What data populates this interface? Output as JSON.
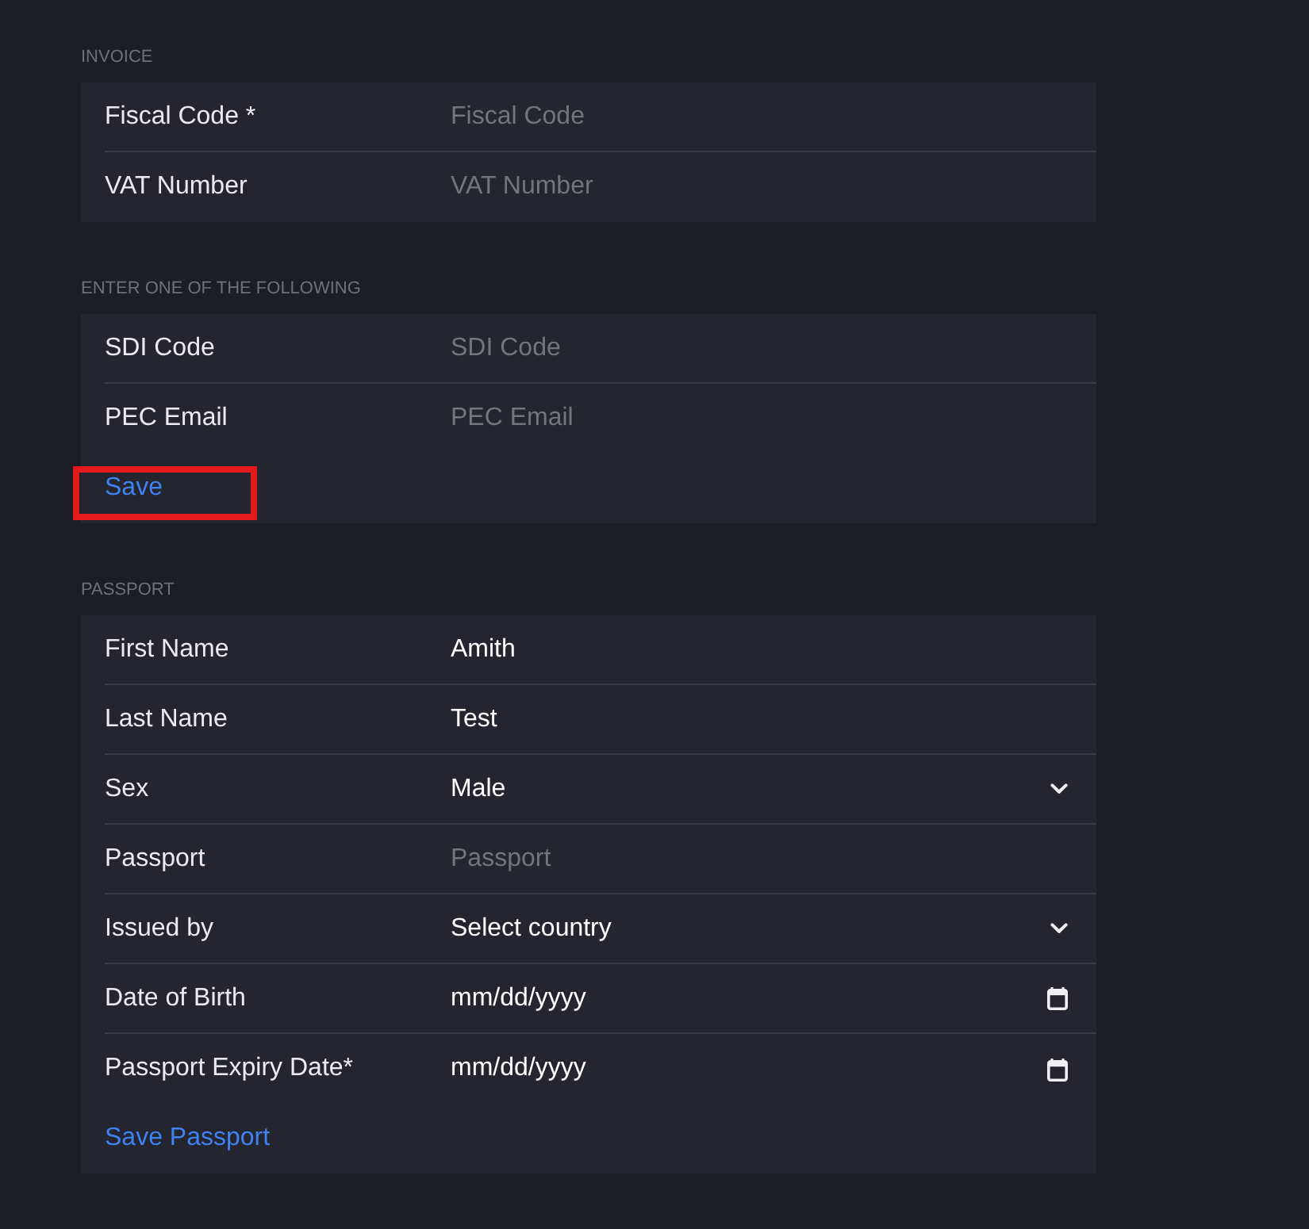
{
  "sections": [
    {
      "title": "INVOICE",
      "rows": [
        {
          "kind": "text",
          "label": "Fiscal Code *",
          "placeholder": "Fiscal Code"
        },
        {
          "kind": "text",
          "label": "VAT Number",
          "placeholder": "VAT Number"
        }
      ]
    },
    {
      "title": "ENTER ONE OF THE FOLLOWING",
      "rows": [
        {
          "kind": "text",
          "label": "SDI Code",
          "placeholder": "SDI Code"
        },
        {
          "kind": "text",
          "label": "PEC Email",
          "placeholder": "PEC Email"
        }
      ],
      "action": {
        "label": "Save",
        "highlighted": true
      }
    },
    {
      "title": "PASSPORT",
      "rows": [
        {
          "kind": "text",
          "label": "First Name",
          "value": "Amith"
        },
        {
          "kind": "text",
          "label": "Last Name",
          "value": "Test"
        },
        {
          "kind": "select",
          "label": "Sex",
          "value": "Male"
        },
        {
          "kind": "text",
          "label": "Passport",
          "placeholder": "Passport"
        },
        {
          "kind": "select",
          "label": "Issued by",
          "value": "Select country"
        },
        {
          "kind": "date",
          "label": "Date of Birth",
          "placeholder": "mm/dd/yyyy"
        },
        {
          "kind": "date",
          "label": "Passport Expiry Date*",
          "placeholder": "mm/dd/yyyy"
        }
      ],
      "action": {
        "label": "Save Passport",
        "highlighted": false
      }
    }
  ]
}
